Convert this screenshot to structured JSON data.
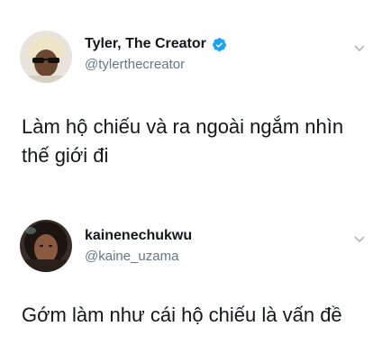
{
  "tweets": [
    {
      "display_name": "Tyler, The Creator",
      "verified": true,
      "handle": "@tylerthecreator",
      "text": "Làm hộ chiếu và ra ngoài ngắm nhìn thế giới đi",
      "avatar_icon": "avatar-photo-icon",
      "menu_icon": "chevron-down-icon"
    },
    {
      "display_name": "kainenechukwu",
      "verified": false,
      "handle": "@kaine_uzama",
      "text": "Gớm làm như cái hộ chiếu là vấn đề",
      "avatar_icon": "avatar-photo-icon",
      "menu_icon": "chevron-down-icon"
    }
  ],
  "colors": {
    "verified_badge": "#1da1f2",
    "handle_text": "#657786",
    "primary_text": "#14171a",
    "chevron": "#aab8c2"
  }
}
